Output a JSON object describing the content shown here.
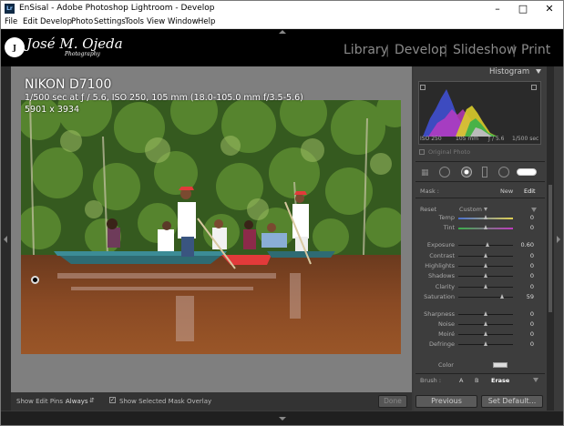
{
  "window": {
    "title": "EnSisal - Adobe Photoshop Lightroom - Develop",
    "app_icon": "Lr"
  },
  "menu": [
    "File",
    "Edit",
    "Develop",
    "Photo",
    "Settings",
    "Tools",
    "View",
    "Window",
    "Help"
  ],
  "logo": {
    "mark": "J",
    "name": "José",
    "surname": "M. Ojeda",
    "tag": "Photography"
  },
  "modules": [
    "Library",
    "Develop",
    "Slideshow",
    "Print"
  ],
  "active_module": "Develop",
  "photo_info": {
    "camera": "NIKON D7100",
    "exposure": "1/500 sec at ƒ / 5.6, ISO 250, 105 mm (18.0-105.0 mm f/3.5-5.6)",
    "dimensions": "5901 x 3934"
  },
  "histogram": {
    "title": "Histogram",
    "iso": "ISO 250",
    "focal": "105 mm",
    "aperture": "ƒ / 5.6",
    "shutter": "1/500 sec",
    "original_photo": "Original Photo"
  },
  "mask": {
    "label": "Mask :",
    "new": "New",
    "edit": "Edit"
  },
  "effect": {
    "reset": "Reset",
    "preset": "Custom"
  },
  "sliders": [
    {
      "id": "temp",
      "label": "Temp",
      "value": "0",
      "pos": 0.5
    },
    {
      "id": "tint",
      "label": "Tint",
      "value": "0",
      "pos": 0.5
    },
    {
      "id": "exposure",
      "label": "Exposure",
      "value": "0.60",
      "pos": 0.54
    },
    {
      "id": "contrast",
      "label": "Contrast",
      "value": "0",
      "pos": 0.5
    },
    {
      "id": "highlights",
      "label": "Highlights",
      "value": "0",
      "pos": 0.5
    },
    {
      "id": "shadows",
      "label": "Shadows",
      "value": "0",
      "pos": 0.5
    },
    {
      "id": "clarity",
      "label": "Clarity",
      "value": "0",
      "pos": 0.5
    },
    {
      "id": "saturation",
      "label": "Saturation",
      "value": "59",
      "pos": 0.8
    },
    {
      "id": "sharpness",
      "label": "Sharpness",
      "value": "0",
      "pos": 0.5
    },
    {
      "id": "noise",
      "label": "Noise",
      "value": "0",
      "pos": 0.5
    },
    {
      "id": "moire",
      "label": "Moiré",
      "value": "0",
      "pos": 0.5
    },
    {
      "id": "defringe",
      "label": "Defringe",
      "value": "0",
      "pos": 0.5
    }
  ],
  "color_label": "Color",
  "brush": {
    "label": "Brush :",
    "a": "A",
    "b": "B",
    "erase": "Erase"
  },
  "toolbar": {
    "show_edit_pins_label": "Show Edit Pins :",
    "show_edit_pins_value": "Always",
    "overlay_label": "Show Selected Mask Overlay",
    "done": "Done"
  },
  "panel_buttons": {
    "previous": "Previous",
    "set_default": "Set Default..."
  }
}
